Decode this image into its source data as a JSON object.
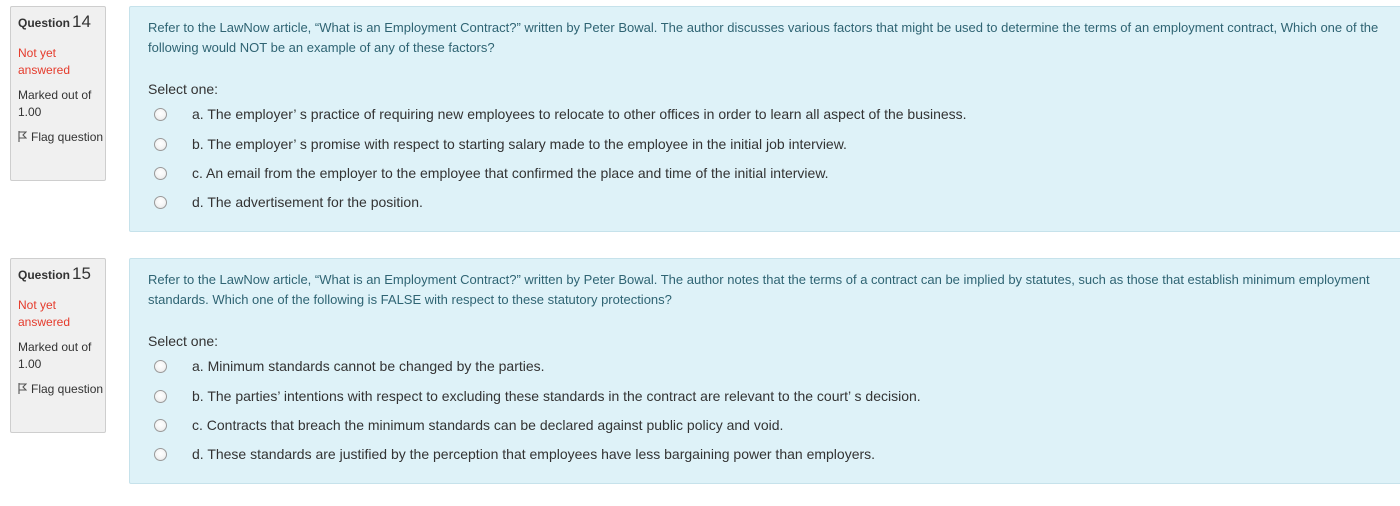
{
  "questions": [
    {
      "label": "Question",
      "number": "14",
      "state": "Not yet answered",
      "grade": "Marked out of 1.00",
      "flag_label": "Flag question",
      "text": "Refer to the LawNow article, “What is an Employment Contract?” written by Peter Bowal. The author discusses various factors that might be used to determine the terms of an employment contract, Which one of the following would NOT be an example of any of these factors?",
      "prompt": "Select one:",
      "options": [
        "a. The employer’ s practice of requiring new employees to relocate to other offices in order to learn all aspect of the business.",
        "b. The employer’ s promise with respect to starting salary made to the employee in the initial job interview.",
        "c. An email from the employer to the employee that confirmed the place and time of the initial interview.",
        "d. The advertisement for the position."
      ]
    },
    {
      "label": "Question",
      "number": "15",
      "state": "Not yet answered",
      "grade": "Marked out of 1.00",
      "flag_label": "Flag question",
      "text": "Refer to the LawNow article, “What is an Employment Contract?” written by Peter Bowal. The author notes that the terms of a contract can be implied by statutes, such as those that establish minimum employment standards. Which one of the following is FALSE with respect to these statutory protections?",
      "prompt": "Select one:",
      "options": [
        "a. Minimum standards cannot be changed by the parties.",
        "b. The parties’ intentions with respect to excluding these standards in the contract are relevant to the court’ s decision.",
        "c. Contracts that breach the minimum standards can be declared against public policy and void.",
        "d. These standards are justified by the perception that employees have less bargaining power than employers."
      ]
    }
  ],
  "colors": {
    "state": "#e53b2c",
    "question_text": "#2f6473",
    "content_bg": "#def2f8",
    "info_bg": "#f0f0f0"
  },
  "icons": {
    "flag": "flag-icon"
  }
}
